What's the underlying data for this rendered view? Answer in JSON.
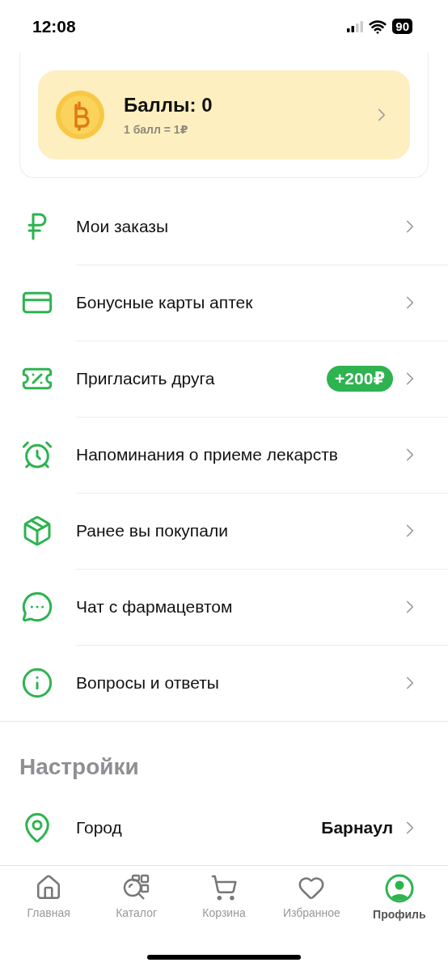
{
  "status_bar": {
    "time": "12:08",
    "battery": "90"
  },
  "points_card": {
    "title": "Баллы: 0",
    "subtitle": "1 балл = 1₽"
  },
  "menu": [
    {
      "label": "Мои заказы"
    },
    {
      "label": "Бонусные карты аптек"
    },
    {
      "label": "Пригласить друга",
      "badge": "+200₽"
    },
    {
      "label": "Напоминания о приеме лекарств"
    },
    {
      "label": "Ранее вы покупали"
    },
    {
      "label": "Чат с фармацевтом"
    },
    {
      "label": "Вопросы и ответы"
    }
  ],
  "settings": {
    "title": "Настройки",
    "items": [
      {
        "label": "Город",
        "value": "Барнаул"
      }
    ]
  },
  "tab_bar": [
    {
      "label": "Главная",
      "selected": false
    },
    {
      "label": "Каталог",
      "selected": false
    },
    {
      "label": "Корзина",
      "selected": false
    },
    {
      "label": "Избранное",
      "selected": false
    },
    {
      "label": "Профиль",
      "selected": true
    }
  ]
}
